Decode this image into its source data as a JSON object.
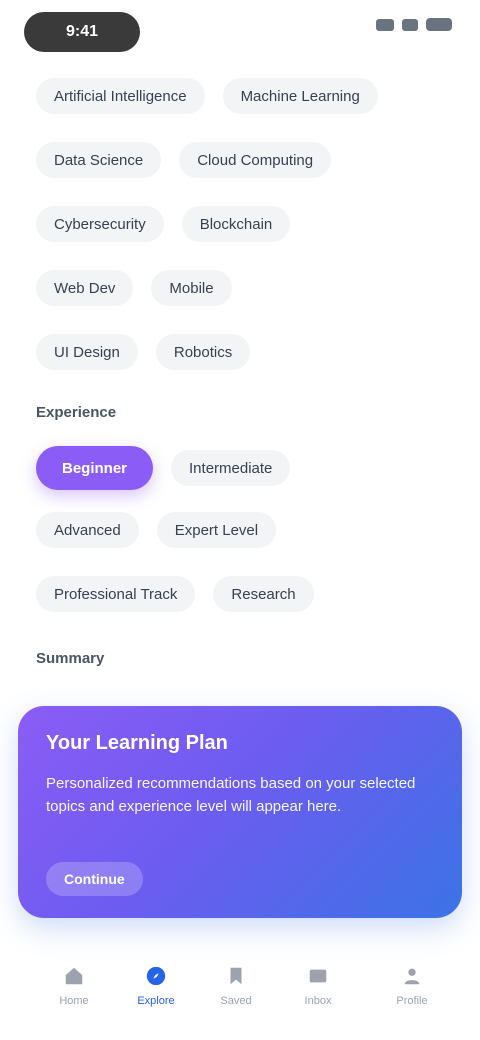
{
  "status": {
    "time": "9:41"
  },
  "chips_group1": [
    {
      "label": "Artificial Intelligence"
    },
    {
      "label": "Machine Learning"
    },
    {
      "label": "Data Science"
    },
    {
      "label": "Cloud Computing"
    },
    {
      "label": "Cybersecurity"
    },
    {
      "label": "Blockchain"
    },
    {
      "label": "Web Dev"
    },
    {
      "label": "Mobile"
    },
    {
      "label": "UI Design"
    },
    {
      "label": "Robotics"
    }
  ],
  "section_interests": "Experience",
  "chips_group2": [
    {
      "label": "Beginner",
      "selected": true
    },
    {
      "label": "Intermediate",
      "selected": false
    },
    {
      "label": "Advanced",
      "selected": false
    },
    {
      "label": "Expert Level",
      "selected": false
    },
    {
      "label": "Professional Track",
      "selected": false
    },
    {
      "label": "Research",
      "selected": false
    }
  ],
  "section_summary": "Summary",
  "promo": {
    "title": "Your Learning Plan",
    "body": "Personalized recommendations based on your selected topics and experience level will appear here.",
    "cta": "Continue"
  },
  "tabs": [
    {
      "label": "Home",
      "active": false
    },
    {
      "label": "Explore",
      "active": true
    },
    {
      "label": "Saved",
      "active": false
    },
    {
      "label": "Inbox",
      "active": false
    },
    {
      "label": "Profile",
      "active": false
    }
  ],
  "colors": {
    "accent": "#8b5cf6",
    "tab_active": "#2563eb",
    "gradient_end": "#3b73e6"
  }
}
